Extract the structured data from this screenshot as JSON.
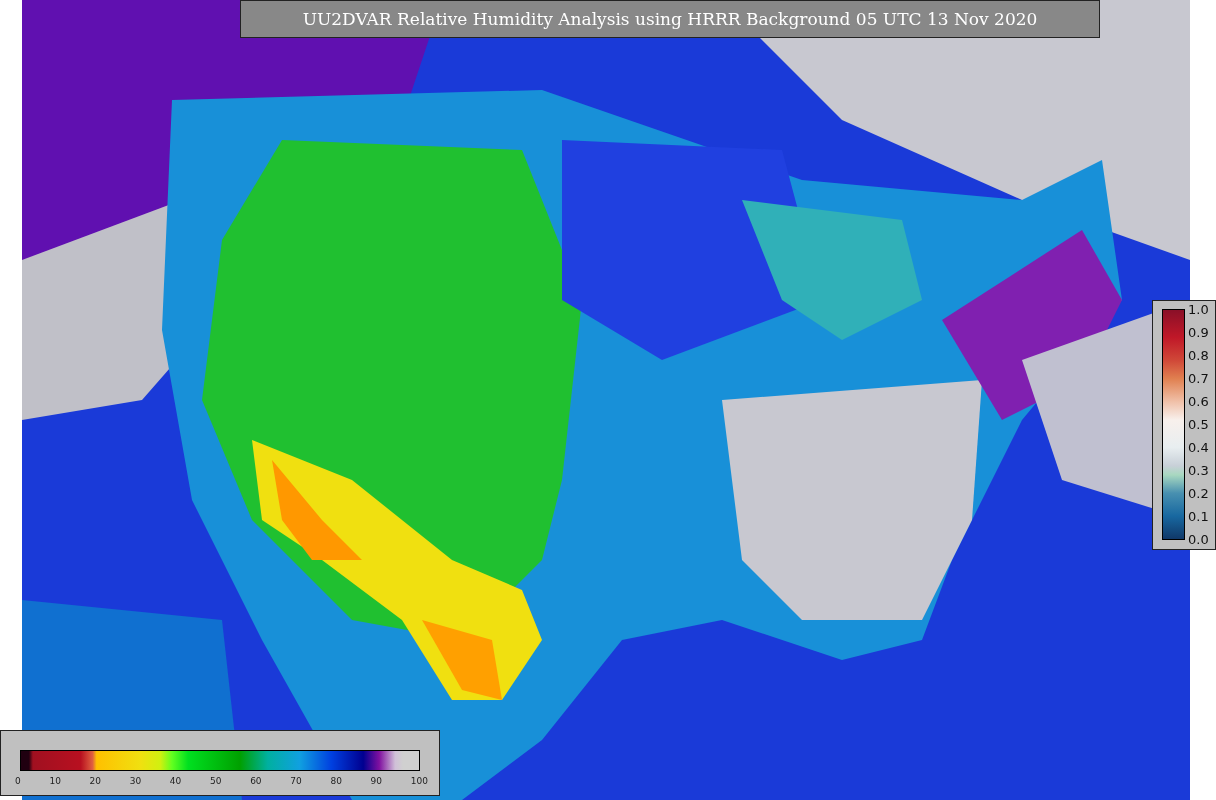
{
  "title": "UU2DVAR Relative Humidity Analysis using HRRR Background 05 UTC 13 Nov 2020",
  "ratio_colorbar": {
    "ticks": [
      "1.0",
      "0.9",
      "0.8",
      "0.7",
      "0.6",
      "0.5",
      "0.4",
      "0.3",
      "0.2",
      "0.1",
      "0.0"
    ]
  },
  "humidity_colorbar": {
    "ticks": [
      "0",
      "10",
      "20",
      "30",
      "40",
      "50",
      "60",
      "70",
      "80",
      "90",
      "100"
    ]
  }
}
